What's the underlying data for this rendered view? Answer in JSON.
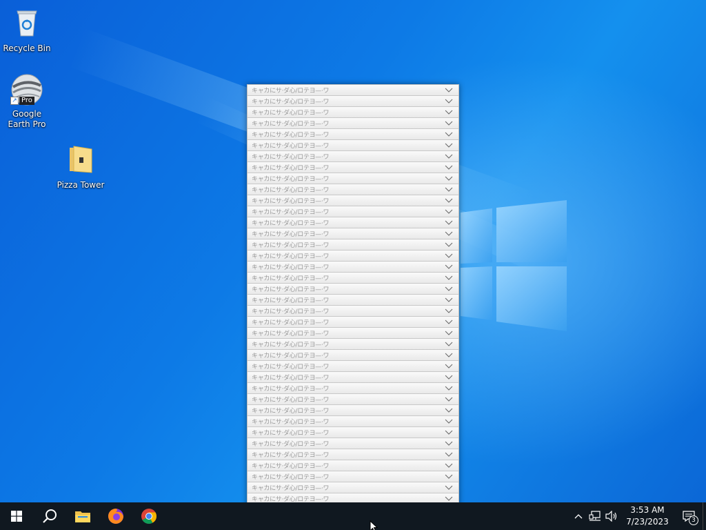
{
  "desktop": {
    "icons": [
      {
        "label": "Recycle Bin",
        "icon": "recycle-bin-icon"
      },
      {
        "label": "Google Earth Pro",
        "icon": "google-earth-icon",
        "badge": "Pro"
      },
      {
        "label": "Pizza Tower",
        "icon": "folder-icon"
      }
    ]
  },
  "dropdown": {
    "row_text": "キャカにサ·ダ心/ロテヨ—·ワ",
    "row_count": 40
  },
  "taskbar": {
    "apps": [
      {
        "name": "Start",
        "icon": "windows-start-icon"
      },
      {
        "name": "Search",
        "icon": "search-icon"
      },
      {
        "name": "File Explorer",
        "icon": "file-explorer-icon"
      },
      {
        "name": "Firefox",
        "icon": "firefox-icon"
      },
      {
        "name": "Chrome",
        "icon": "chrome-icon"
      }
    ],
    "clock": {
      "time": "3:53 AM",
      "date": "7/23/2023"
    },
    "notifications": "3"
  },
  "colors": {
    "taskbar": "#101820",
    "desktop_blue": "#0a5fd8"
  }
}
